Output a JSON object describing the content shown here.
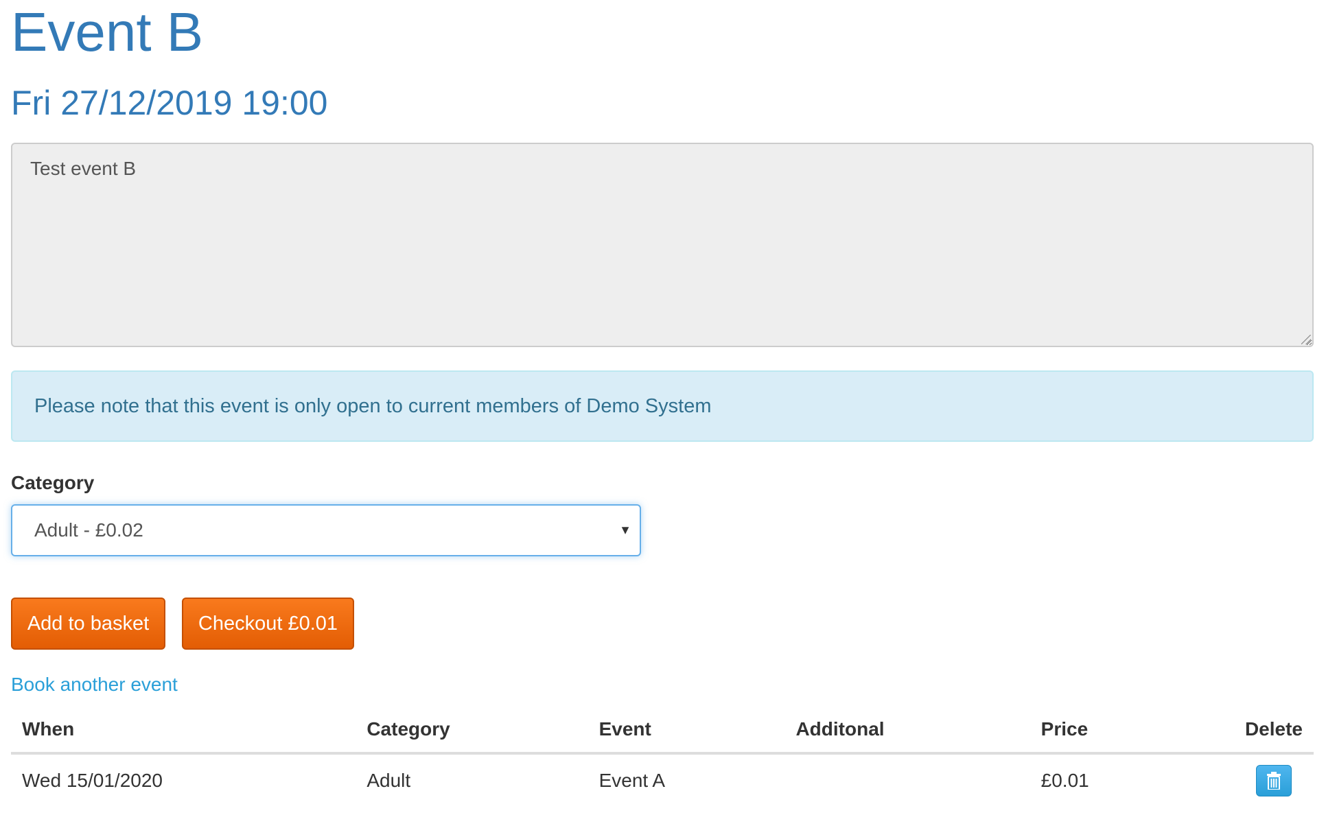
{
  "event": {
    "title": "Event B",
    "datetime": "Fri 27/12/2019 19:00",
    "description": "Test event B"
  },
  "notice": {
    "text": "Please note that this event is only open to current members of Demo System"
  },
  "category": {
    "label": "Category",
    "selected": "Adult - £0.02"
  },
  "actions": {
    "add_to_basket": "Add to basket",
    "checkout": "Checkout £0.01",
    "book_another": "Book another event"
  },
  "basket": {
    "headers": [
      "When",
      "Category",
      "Event",
      "Additonal",
      "Price",
      "Delete"
    ],
    "rows": [
      {
        "when": "Wed 15/01/2020",
        "category": "Adult",
        "event": "Event A",
        "additional": "",
        "price": "£0.01",
        "delete_icon": "trash-icon"
      }
    ]
  },
  "colors": {
    "heading": "#337ab7",
    "button": "#f06d0f",
    "link": "#2a9fd8",
    "alert_bg": "#d9edf7",
    "alert_text": "#31708f",
    "delete_button": "#2a9fd8"
  }
}
